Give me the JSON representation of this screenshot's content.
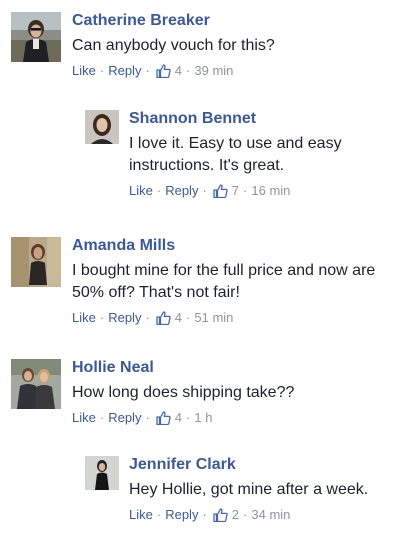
{
  "comments": [
    {
      "name": "Catherine Breaker",
      "text": "Can anybody vouch for this?",
      "like_label": "Like",
      "reply_label": "Reply",
      "likes": "4",
      "time": "39 min",
      "avatar_icon": "user-photo"
    },
    {
      "name": "Shannon Bennet",
      "text": "I love it. Easy to use and easy instructions. It's great.",
      "like_label": "Like",
      "reply_label": "Reply",
      "likes": "7",
      "time": "16 min",
      "avatar_icon": "user-photo"
    },
    {
      "name": "Amanda Mills",
      "text": "I bought mine for the full price and now are 50% off? That's not fair!",
      "like_label": "Like",
      "reply_label": "Reply",
      "likes": "4",
      "time": "51 min",
      "avatar_icon": "user-photo"
    },
    {
      "name": "Hollie Neal",
      "text": "How long does shipping take??",
      "like_label": "Like",
      "reply_label": "Reply",
      "likes": "4",
      "time": "1 h",
      "avatar_icon": "user-photo"
    },
    {
      "name": "Jennifer Clark",
      "text": "Hey Hollie, got mine after a week.",
      "like_label": "Like",
      "reply_label": "Reply",
      "likes": "2",
      "time": "34 min",
      "avatar_icon": "user-photo"
    }
  ],
  "separator": "·",
  "colors": {
    "name": "#3b5998",
    "text": "#1d2129",
    "meta": "#90949c"
  }
}
